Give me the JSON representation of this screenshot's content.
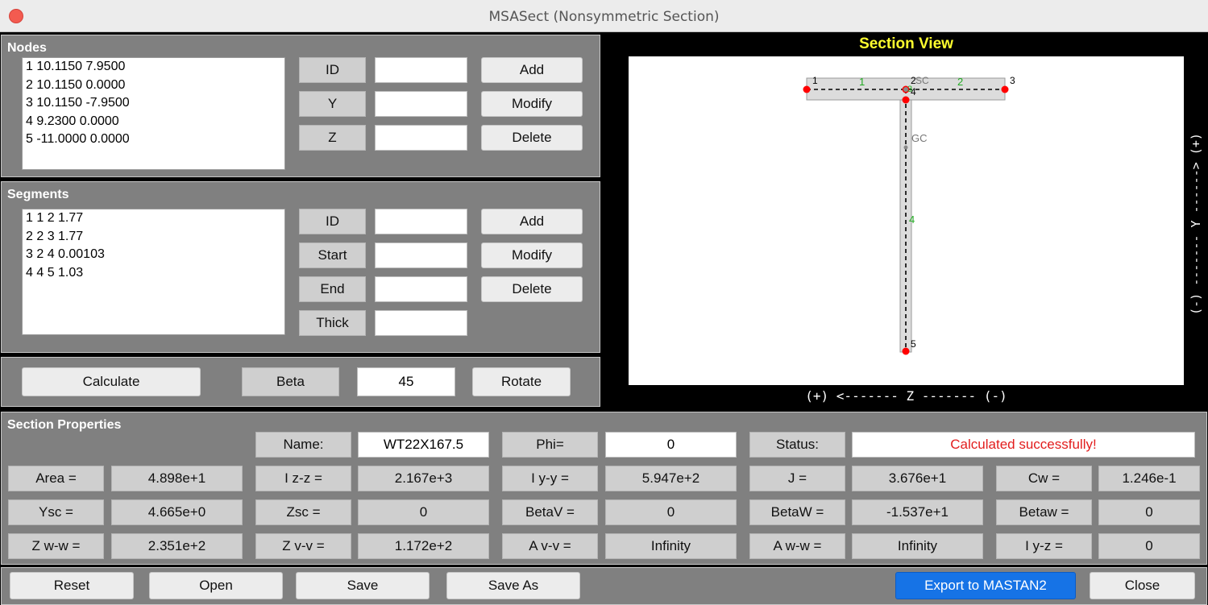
{
  "window": {
    "title": "MSASect (Nonsymmetric Section)"
  },
  "nodes": {
    "title": "Nodes",
    "items": [
      "1 10.1150 7.9500",
      "2 10.1150 0.0000",
      "3 10.1150 -7.9500",
      "4 9.2300 0.0000",
      "5 -11.0000 0.0000"
    ],
    "labels": {
      "id": "ID",
      "y": "Y",
      "z": "Z"
    },
    "values": {
      "id": "",
      "y": "",
      "z": ""
    },
    "buttons": {
      "add": "Add",
      "modify": "Modify",
      "delete": "Delete"
    }
  },
  "segments": {
    "title": "Segments",
    "items": [
      "1 1 2 1.77",
      "2 2 3 1.77",
      "3 2 4 0.00103",
      "4 4 5 1.03"
    ],
    "labels": {
      "id": "ID",
      "start": "Start",
      "end": "End",
      "thick": "Thick"
    },
    "values": {
      "id": "",
      "start": "",
      "end": "",
      "thick": ""
    },
    "buttons": {
      "add": "Add",
      "modify": "Modify",
      "delete": "Delete"
    }
  },
  "calc": {
    "calculate": "Calculate",
    "beta_label": "Beta",
    "beta_value": "45",
    "rotate": "Rotate"
  },
  "section_view": {
    "title": "Section View",
    "z_axis": "(+) <------- Z ------- (-)",
    "y_axis": "(-) ------- Y ------> (+)",
    "node_labels": [
      "1",
      "2",
      "3",
      "4",
      "5"
    ],
    "segment_labels": [
      "1",
      "2",
      "3",
      "4"
    ],
    "sc_label": "SC",
    "gc_label": "GC",
    "colors": {
      "node": "#ff0000",
      "segment_label": "#22aa22",
      "section_fill": "#dcdcdc",
      "centerline": "#000000"
    }
  },
  "properties": {
    "title": "Section Properties",
    "name_label": "Name:",
    "name_value": "WT22X167.5",
    "phi_label": "Phi=",
    "phi_value": "0",
    "status_label": "Status:",
    "status_value": "Calculated successfully!",
    "rows": [
      [
        {
          "label": "Area =",
          "value": "4.898e+1"
        },
        {
          "label": "I z-z =",
          "value": "2.167e+3"
        },
        {
          "label": "I y-y =",
          "value": "5.947e+2"
        },
        {
          "label": "J =",
          "value": "3.676e+1"
        },
        {
          "label": "Cw =",
          "value": "1.246e-1"
        }
      ],
      [
        {
          "label": "Ysc =",
          "value": "4.665e+0"
        },
        {
          "label": "Zsc =",
          "value": "0"
        },
        {
          "label": "BetaV =",
          "value": "0"
        },
        {
          "label": "BetaW =",
          "value": "-1.537e+1"
        },
        {
          "label": "Betaw =",
          "value": "0"
        }
      ],
      [
        {
          "label": "Z w-w =",
          "value": "2.351e+2"
        },
        {
          "label": "Z v-v =",
          "value": "1.172e+2"
        },
        {
          "label": "A v-v =",
          "value": "Infinity"
        },
        {
          "label": "A w-w =",
          "value": "Infinity"
        },
        {
          "label": "I y-z =",
          "value": "0"
        }
      ]
    ],
    "colors": {
      "status_text": "#e21d1d"
    }
  },
  "footer": {
    "reset": "Reset",
    "open": "Open",
    "save": "Save",
    "save_as": "Save As",
    "export": "Export to MASTAN2",
    "close": "Close"
  },
  "theme": {
    "panel_bg": "#808080",
    "window_bg": "#000000",
    "accent": "#1673e6",
    "title_yellow": "#ffff2e"
  }
}
